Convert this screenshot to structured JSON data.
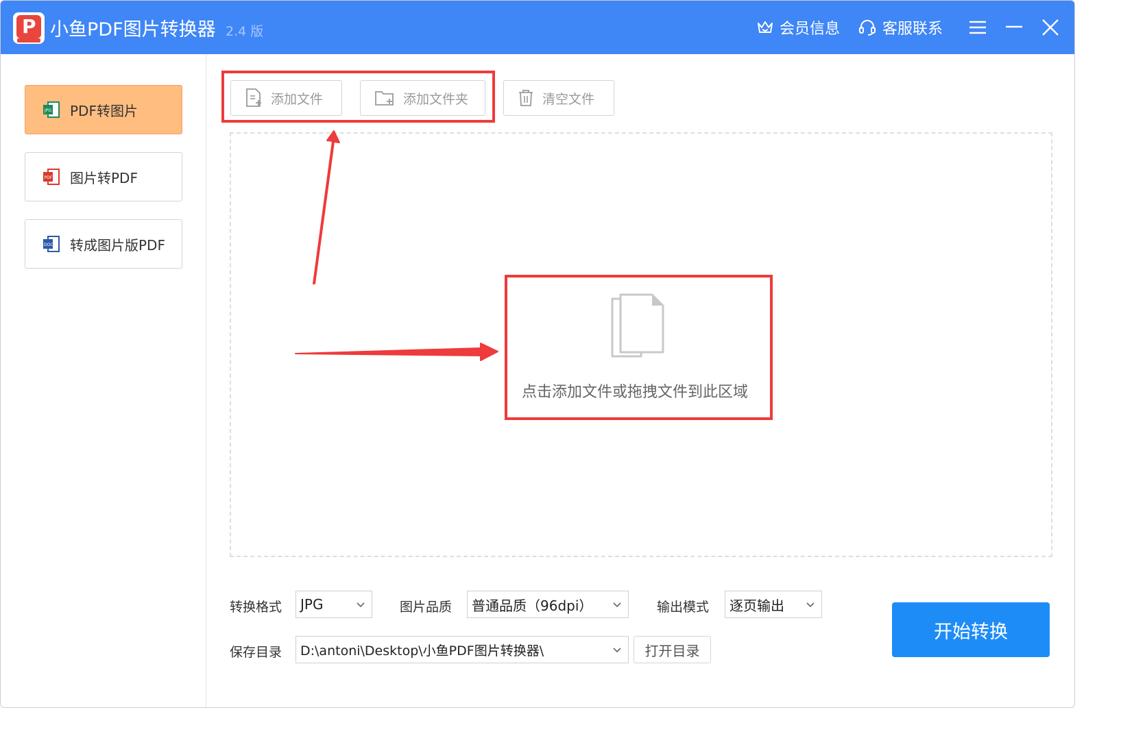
{
  "app": {
    "title": "小鱼PDF图片转换器",
    "version": "2.4 版",
    "logo_icon": "pdf-logo-icon",
    "member_info": "会员信息",
    "customer_service": "客服联系"
  },
  "colors": {
    "titlebar": "#3f86f6",
    "active_nav": "#ffbd80",
    "highlight_box": "#ee3b3b",
    "start_button": "#1e8cf7"
  },
  "sidebar": {
    "items": [
      {
        "label": "PDF转图片",
        "icon": "jpg-file-icon",
        "active": true
      },
      {
        "label": "图片转PDF",
        "icon": "pdf-file-icon",
        "active": false
      },
      {
        "label": "转成图片版PDF",
        "icon": "doc-file-icon",
        "active": false
      }
    ]
  },
  "toolbar": {
    "add_file": "添加文件",
    "add_folder": "添加文件夹",
    "clear_files": "清空文件"
  },
  "dropzone": {
    "hint": "点击添加文件或拖拽文件到此区域",
    "icon": "documents-icon"
  },
  "settings": {
    "format_label": "转换格式",
    "format_value": "JPG",
    "quality_label": "图片品质",
    "quality_value": "普通品质（96dpi）",
    "output_mode_label": "输出模式",
    "output_mode_value": "逐页输出",
    "save_dir_label": "保存目录",
    "save_dir_value": "D:\\antoni\\Desktop\\小鱼PDF图片转换器\\",
    "open_dir_button": "打开目录"
  },
  "start_button": "开始转换"
}
